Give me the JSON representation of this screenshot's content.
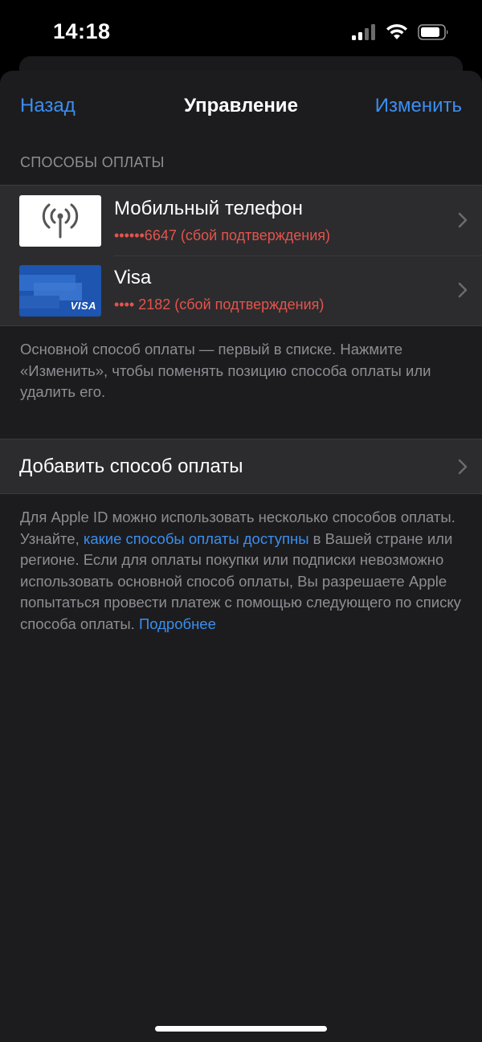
{
  "status_bar": {
    "time": "14:18",
    "icons": [
      "signal-icon",
      "wifi-icon",
      "battery-icon"
    ]
  },
  "nav": {
    "back_label": "Назад",
    "title": "Управление",
    "edit_label": "Изменить"
  },
  "payment_section": {
    "header": "СПОСОБЫ ОПЛАТЫ",
    "methods": [
      {
        "title": "Мобильный телефон",
        "subtitle": "••••••6647 (сбой подтверждения)",
        "icon": "antenna-icon"
      },
      {
        "title": "Visa",
        "subtitle": "•••• 2182 (сбой подтверждения)",
        "icon": "visa-card-icon",
        "card_brand": "VISA"
      }
    ],
    "footer": "Основной способ оплаты — первый в списке. Нажмите «Изменить», чтобы поменять позицию способа оплаты или удалить его."
  },
  "add_payment": {
    "label": "Добавить способ оплаты"
  },
  "info": {
    "text_before_link": "Для Apple ID можно использовать несколько способов оплаты. Узнайте, ",
    "link1": "какие способы оплаты доступны",
    "text_middle": " в Вашей стране или регионе. Если для оплаты покупки или подписки невозможно использовать основной способ оплаты, Вы разрешаете Apple попытаться провести платеж с помощью следующего по списку способа оплаты. ",
    "link2": "Подробнее"
  },
  "colors": {
    "accent": "#3b8ef0",
    "error": "#e5534b",
    "background": "#1c1c1e",
    "cell": "#2c2c2e",
    "secondary_text": "#8d8d93"
  }
}
